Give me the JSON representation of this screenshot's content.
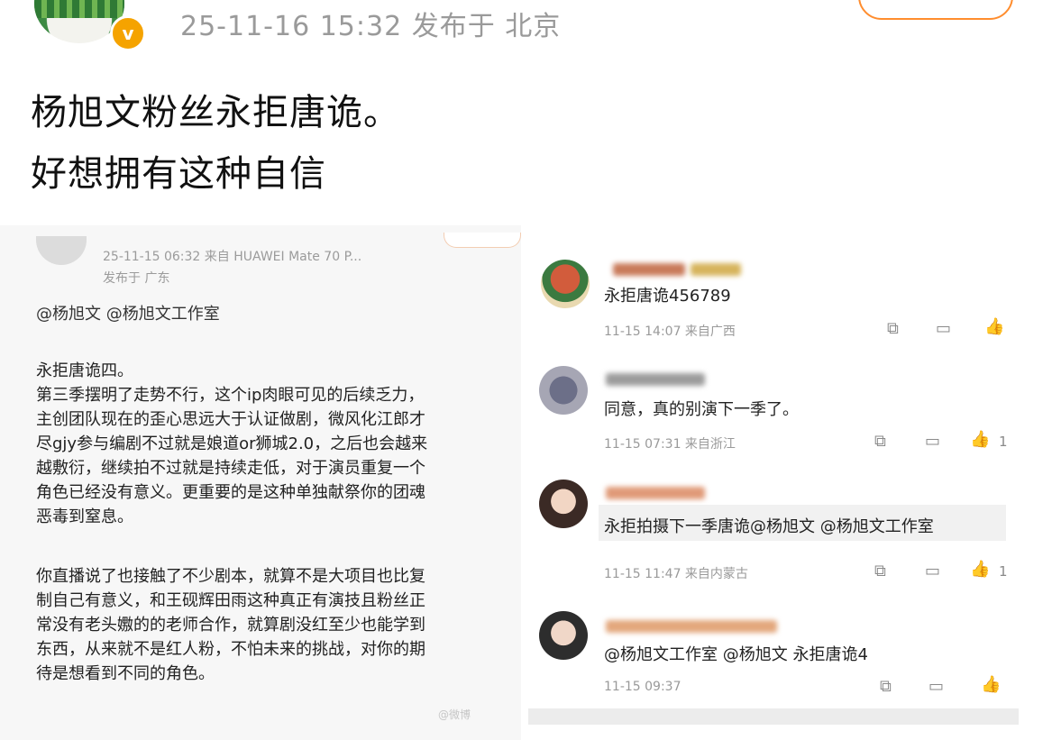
{
  "post": {
    "meta": "25-11-16 15:32  发布于 北京",
    "verified_badge": "v",
    "text_line1": "杨旭文粉丝永拒唐诡。",
    "text_line2": "好想拥有这种自信"
  },
  "left_screenshot": {
    "meta_line": "25-11-15 06:32  来自 HUAWEI Mate 70 P...",
    "location": "发布于 广东",
    "mentions": "@杨旭文 @杨旭文工作室",
    "paragraph1": [
      "永拒唐诡四。",
      "第三季摆明了走势不行，这个ip肉眼可见的后续乏力，",
      "主创团队现在的歪心思远大于认证做剧，微风化江郎才",
      "尽gjy参与编剧不过就是娘道or狮城2.0，之后也会越来",
      "越敷衍，继续拍不过就是持续走低，对于演员重复一个",
      "角色已经没有意义。更重要的是这种单独献祭你的团魂",
      "恶毒到窒息。"
    ],
    "paragraph2": [
      "你直播说了也接触了不少剧本，就算不是大项目也比复",
      "制自己有意义，和王砚辉田雨这种真正有演技且粉丝正",
      "常没有老头嫐的的老师合作，就算剧没红至少也能学到",
      "东西，从来就不是红人粉，不怕未来的挑战，对你的期",
      "待是想看到不同的角色。"
    ]
  },
  "comments": [
    {
      "text": "永拒唐诡456789",
      "meta": "11-15 14:07 来自广西",
      "likes": ""
    },
    {
      "text": "同意，真的别演下一季了。",
      "meta": "11-15 07:31 来自浙江",
      "likes": "1"
    },
    {
      "text": "永拒拍摄下一季唐诡@杨旭文 @杨旭文工作室",
      "meta": "11-15 11:47 来自内蒙古",
      "likes": "1"
    },
    {
      "text": "@杨旭文工作室 @杨旭文 永拒唐诡4",
      "meta": "11-15 09:37",
      "likes": ""
    }
  ],
  "icons": [
    "share-icon",
    "comment-icon",
    "like-icon"
  ],
  "colors": {
    "accent_orange": "#ff8d2e",
    "badge": "#f5a300",
    "meta_gray": "#9a9a9a"
  }
}
